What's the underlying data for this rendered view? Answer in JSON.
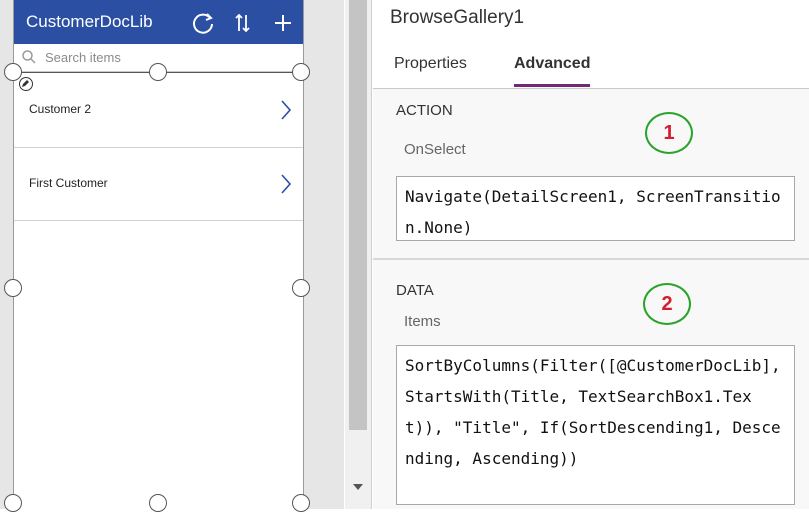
{
  "app": {
    "title": "CustomerDocLib",
    "icons": [
      "refresh-icon",
      "sort-icon",
      "add-icon"
    ],
    "bar_color": "#2b4fa3"
  },
  "search": {
    "placeholder": "Search items",
    "value": ""
  },
  "gallery": {
    "items": [
      {
        "title": "Customer 2"
      },
      {
        "title": "First Customer"
      }
    ]
  },
  "panel": {
    "control_name": "BrowseGallery1",
    "tabs": [
      {
        "label": "Properties",
        "selected": false
      },
      {
        "label": "Advanced",
        "selected": true
      }
    ],
    "accent_color": "#742774",
    "sections": [
      {
        "title": "ACTION",
        "badge": "1",
        "property": "OnSelect",
        "formula": "Navigate(DetailScreen1, ScreenTransition.None)"
      },
      {
        "title": "DATA",
        "badge": "2",
        "property": "Items",
        "formula": "SortByColumns(Filter([@CustomerDocLib], StartsWith(Title, TextSearchBox1.Text)), \"Title\", If(SortDescending1, Descending, Ascending))"
      }
    ]
  }
}
